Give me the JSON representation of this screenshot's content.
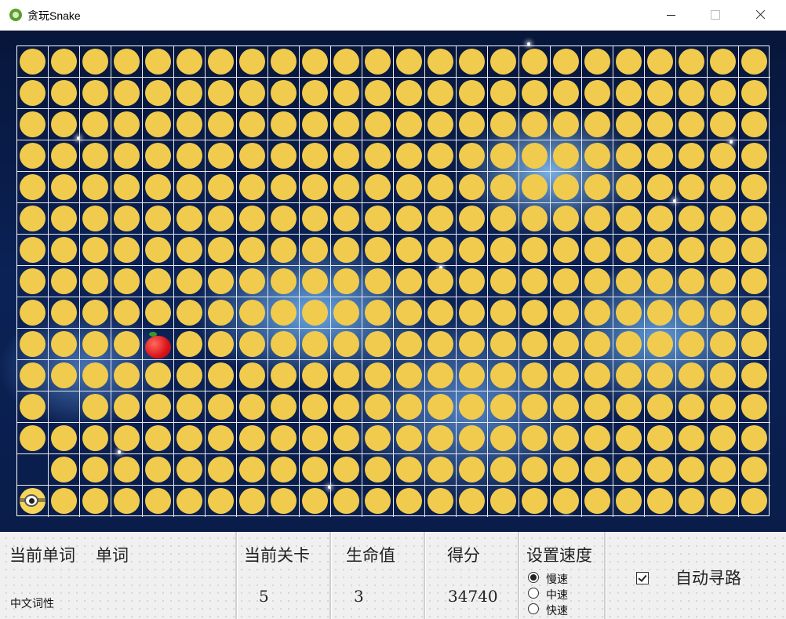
{
  "window": {
    "title": "贪玩Snake",
    "icon": "snake-app-icon"
  },
  "board": {
    "columns": 24,
    "rows": 15,
    "pellet_color": "#f0cb4e",
    "background": "starry-night-blue",
    "empty_cells": [
      [
        11,
        1
      ],
      [
        13,
        0
      ],
      [
        14,
        0
      ]
    ],
    "apple": {
      "col": 4,
      "row": 9,
      "icon": "red-apple-icon"
    },
    "snake_head": {
      "col": 0,
      "row": 14,
      "icon": "snake-head-eye-icon"
    }
  },
  "panel": {
    "current_word_label": "当前单词",
    "current_word_value": "单词",
    "chinese_pos_label": "中文词性",
    "level_label": "当前关卡",
    "level_value": "5",
    "lives_label": "生命值",
    "lives_value": "3",
    "score_label": "得分",
    "score_value": "34740",
    "speed_label": "设置速度",
    "speed_options": [
      "慢速",
      "中速",
      "快速"
    ],
    "speed_selected": "慢速",
    "auto_path_label": "自动寻路",
    "auto_path_checked": true
  }
}
